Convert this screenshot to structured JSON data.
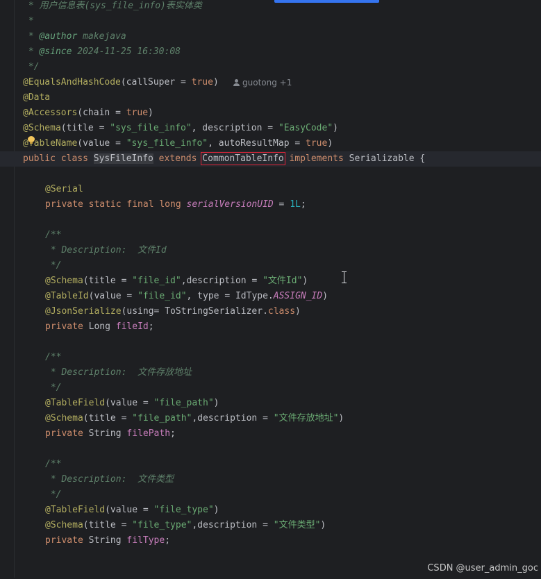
{
  "editor": {
    "l0": {
      "a": " * 用户信息表(sys_file_info)表实体类"
    },
    "l1": {
      "a": " *"
    },
    "l2": {
      "a": " * ",
      "b": "@author",
      "c": " makejava"
    },
    "l3": {
      "a": " * ",
      "b": "@since",
      "c": " 2024-11-25 16:30:08"
    },
    "l4": {
      "a": " */"
    },
    "l5": {
      "a": "@EqualsAndHashCode",
      "b": "(callSuper = ",
      "c": "true",
      "d": ")"
    },
    "l6": {
      "a": "@Data"
    },
    "l7": {
      "a": "@Accessors",
      "b": "(chain = ",
      "c": "true",
      "d": ")"
    },
    "l8": {
      "a": "@Schema",
      "b": "(title = ",
      "c": "\"sys_file_info\"",
      "d": ", description = ",
      "e": "\"EasyCode\"",
      "f": ")"
    },
    "l9": {
      "a": "@",
      "b": "TableName",
      "c": "(value = ",
      "d": "\"sys_file_info\"",
      "e": ", autoResultMap = ",
      "f": "true",
      "g": ")"
    },
    "l10": {
      "a": "public class ",
      "b": "SysFileInfo",
      "c": " extends ",
      "d": "CommonTableInfo",
      "e": " implements ",
      "f": "Serializable {"
    },
    "l12": {
      "a": "@Serial"
    },
    "l13": {
      "a": "private static final long ",
      "b": "serialVersionUID",
      "c": " = ",
      "d": "1L",
      "e": ";"
    },
    "l15": {
      "a": "/**"
    },
    "l16": {
      "a": " * Description:  文件Id"
    },
    "l17": {
      "a": " */"
    },
    "l18": {
      "a": "@Schema",
      "b": "(title = ",
      "c": "\"file_id\"",
      "d": ",description = ",
      "e": "\"文件Id\"",
      "f": ")"
    },
    "l19": {
      "a": "@TableId",
      "b": "(value = ",
      "c": "\"file_id\"",
      "d": ", type = IdType.",
      "e": "ASSIGN_ID",
      "f": ")"
    },
    "l20": {
      "a": "@JsonSerialize",
      "b": "(using= ToStringSerializer.",
      "c": "class",
      "d": ")"
    },
    "l21": {
      "a": "private ",
      "b": "Long ",
      "c": "fileId",
      "d": ";"
    },
    "l23": {
      "a": "/**"
    },
    "l24": {
      "a": " * Description:  文件存放地址"
    },
    "l25": {
      "a": " */"
    },
    "l26": {
      "a": "@TableField",
      "b": "(value = ",
      "c": "\"file_path\"",
      "d": ")"
    },
    "l27": {
      "a": "@Schema",
      "b": "(title = ",
      "c": "\"file_path\"",
      "d": ",description = ",
      "e": "\"文件存放地址\"",
      "f": ")"
    },
    "l28": {
      "a": "private ",
      "b": "String ",
      "c": "filePath",
      "d": ";"
    },
    "l30": {
      "a": "/**"
    },
    "l31": {
      "a": " * Description:  文件类型"
    },
    "l32": {
      "a": " */"
    },
    "l33": {
      "a": "@TableField",
      "b": "(value = ",
      "c": "\"file_type\"",
      "d": ")"
    },
    "l34": {
      "a": "@Schema",
      "b": "(title = ",
      "c": "\"file_type\"",
      "d": ",description = ",
      "e": "\"文件类型\"",
      "f": ")"
    },
    "l35": {
      "a": "private ",
      "b": "String ",
      "c": "filType",
      "d": ";"
    }
  },
  "inlay_hint": {
    "author": "guotong +1",
    "icon": "person-icon"
  },
  "watermark": "CSDN @user_admin_goc",
  "colors": {
    "background": "#1e1f22",
    "keyword": "#cf8e6d",
    "string": "#6aab73",
    "annotation": "#b3ae60",
    "field": "#c77dbb",
    "number": "#2aacb8",
    "doc_comment": "#5f826b",
    "highlight_box": "#e0243a"
  }
}
